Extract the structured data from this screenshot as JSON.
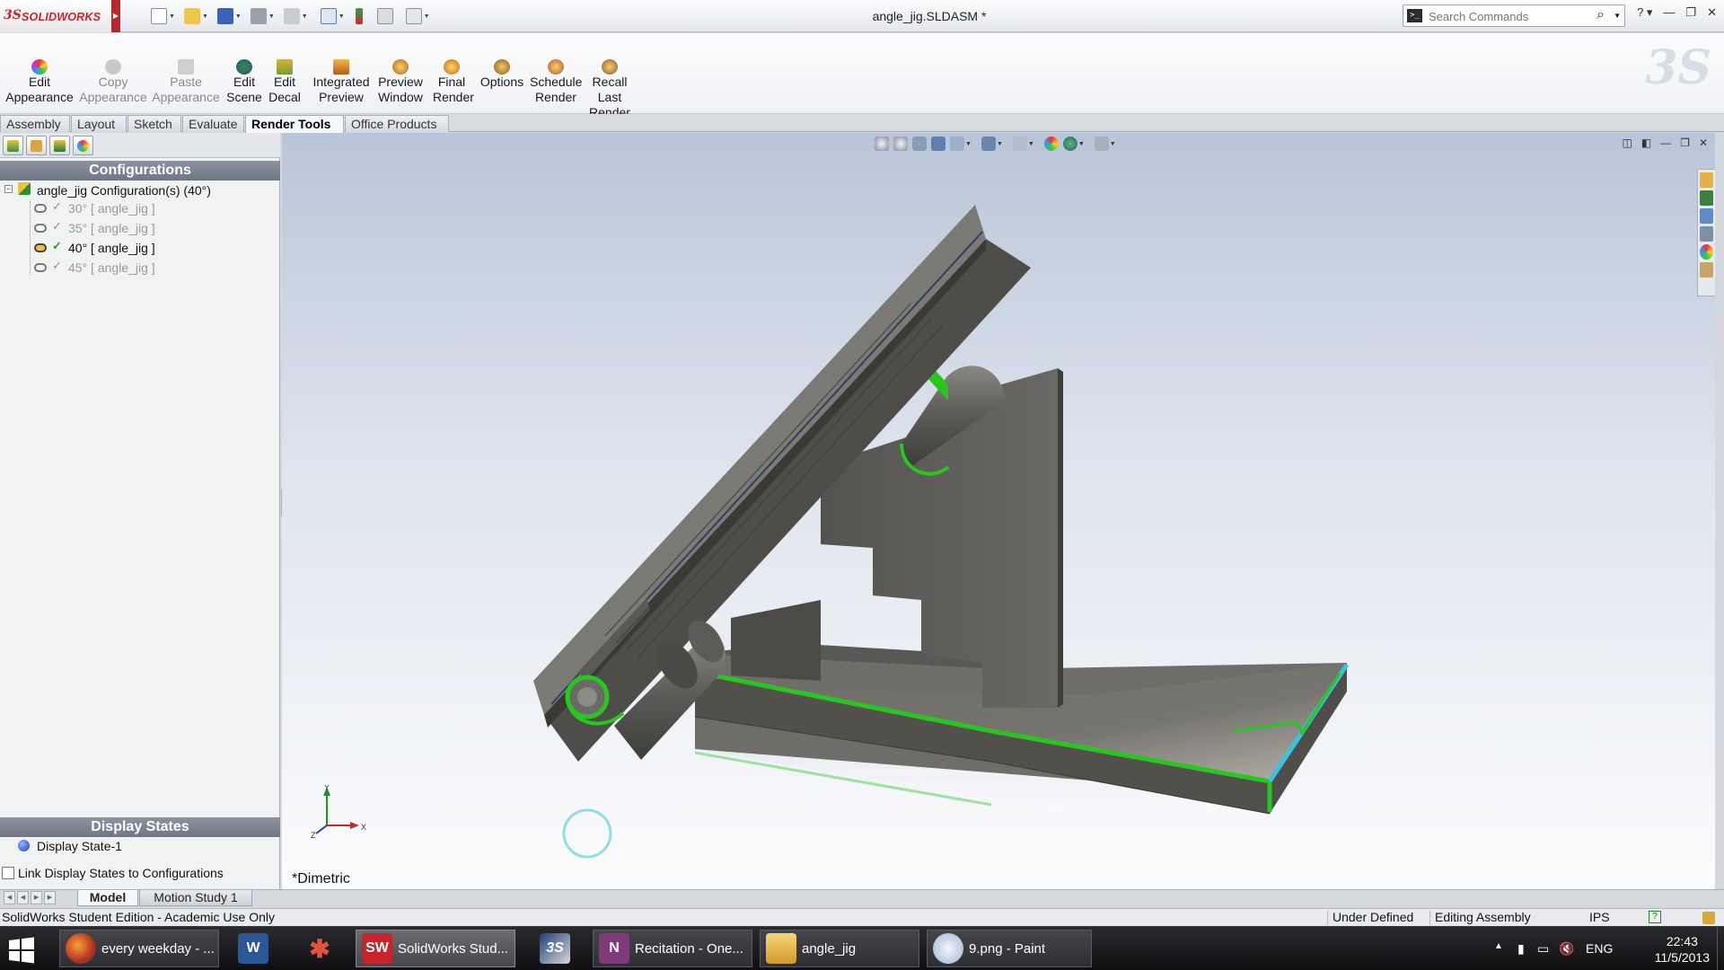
{
  "app": {
    "brand": "SOLIDWORKS",
    "document_title": "angle_jig.SLDASM *",
    "search": {
      "placeholder": "Search Commands"
    },
    "help_glyph": "?"
  },
  "command_manager": {
    "buttons": [
      {
        "label": "Edit\nAppearance",
        "enabled": true,
        "icon": "edit-appearance-icon"
      },
      {
        "label": "Copy\nAppearance",
        "enabled": false,
        "icon": "copy-appearance-icon"
      },
      {
        "label": "Paste\nAppearance",
        "enabled": false,
        "icon": "paste-appearance-icon"
      },
      {
        "label": "Edit\nScene",
        "enabled": true,
        "icon": "edit-scene-icon"
      },
      {
        "label": "Edit\nDecal",
        "enabled": true,
        "icon": "edit-decal-icon"
      },
      {
        "label": "Integrated\nPreview",
        "enabled": true,
        "icon": "integrated-preview-icon"
      },
      {
        "label": "Preview\nWindow",
        "enabled": true,
        "icon": "preview-window-icon"
      },
      {
        "label": "Final\nRender",
        "enabled": true,
        "icon": "final-render-icon"
      },
      {
        "label": "Options",
        "enabled": true,
        "icon": "options-icon"
      },
      {
        "label": "Schedule\nRender",
        "enabled": true,
        "icon": "schedule-render-icon"
      },
      {
        "label": "Recall\nLast\nRender",
        "enabled": true,
        "icon": "recall-last-render-icon"
      }
    ]
  },
  "tabs": [
    {
      "label": "Assembly",
      "active": false
    },
    {
      "label": "Layout",
      "active": false
    },
    {
      "label": "Sketch",
      "active": false
    },
    {
      "label": "Evaluate",
      "active": false
    },
    {
      "label": "Render Tools",
      "active": true
    },
    {
      "label": "Office Products",
      "active": false
    }
  ],
  "configuration_manager": {
    "header": "Configurations",
    "root": {
      "label": "angle_jig Configuration(s)  (40°)"
    },
    "items": [
      {
        "label": "30° [ angle_jig ]",
        "active": false
      },
      {
        "label": "35° [ angle_jig ]",
        "active": false
      },
      {
        "label": "40° [ angle_jig ]",
        "active": true
      },
      {
        "label": "45° [ angle_jig ]",
        "active": false
      }
    ],
    "display_states_header": "Display States",
    "display_state": "Display State-1",
    "link_checkbox": {
      "label": "Link Display States to Configurations",
      "checked": false
    }
  },
  "viewport": {
    "view_orientation": "*Dimetric",
    "axes": {
      "x": "X",
      "y": "Y",
      "z": "Z"
    }
  },
  "bottom_tabs": [
    {
      "label": "Model",
      "active": true
    },
    {
      "label": "Motion Study 1",
      "active": false
    }
  ],
  "status_bar": {
    "left": "SolidWorks Student Edition - Academic Use Only",
    "state": "Under Defined",
    "mode": "Editing Assembly",
    "units": "IPS",
    "help": "?"
  },
  "taskbar": {
    "items": [
      {
        "label": "every weekday - ...",
        "icon": "firefox-icon",
        "state": "open"
      },
      {
        "label": "",
        "icon": "word-icon",
        "state": "pinned"
      },
      {
        "label": "",
        "icon": "zune-icon",
        "state": "pinned"
      },
      {
        "label": "SolidWorks Stud...",
        "icon": "solidworks-icon",
        "state": "active"
      },
      {
        "label": "",
        "icon": "3dvia-icon",
        "state": "pinned"
      },
      {
        "label": "Recitation - One...",
        "icon": "onenote-icon",
        "state": "open"
      },
      {
        "label": "angle_jig",
        "icon": "folder-icon",
        "state": "open"
      },
      {
        "label": "9.png - Paint",
        "icon": "paint-icon",
        "state": "open"
      }
    ],
    "language": "ENG",
    "time": "22:43",
    "date": "11/5/2013"
  },
  "colors": {
    "edge_highlight": "#21c21a",
    "edge_cyan": "#32c6e0",
    "part_gray": "#7a7873",
    "brand_red": "#d2232a"
  }
}
